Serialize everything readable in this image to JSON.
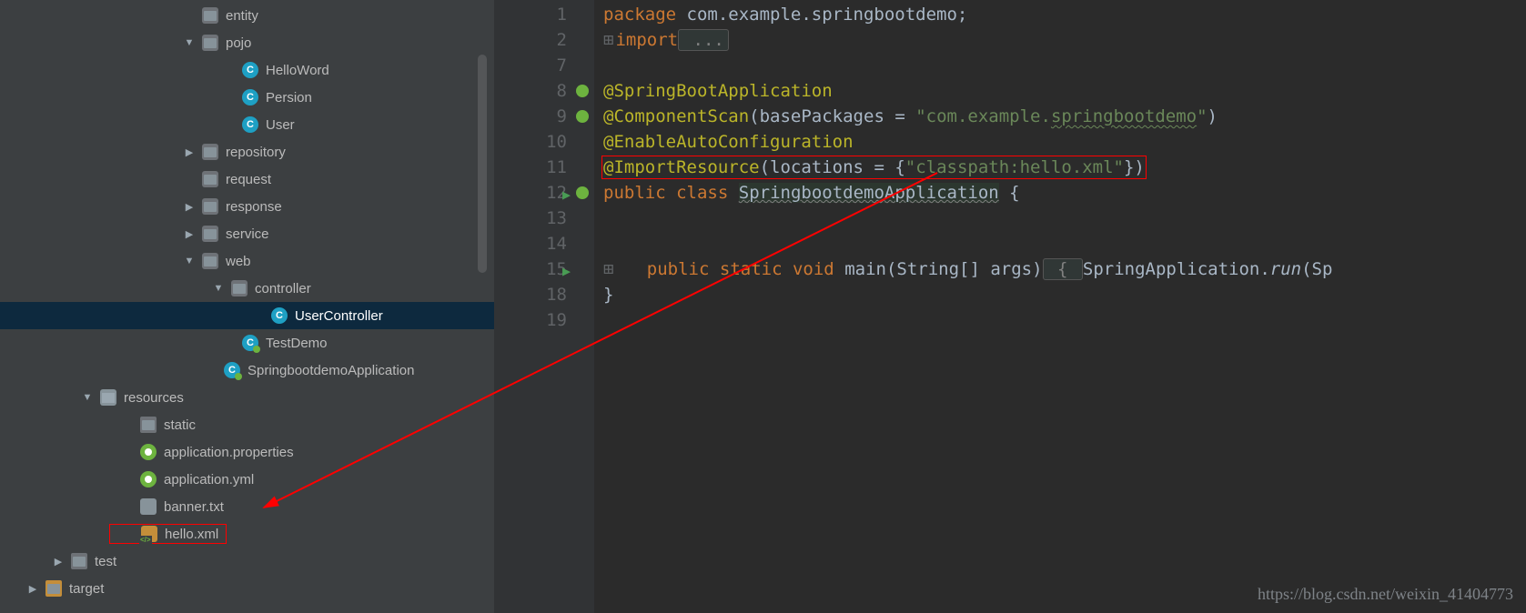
{
  "tree": {
    "entity": "entity",
    "pojo": "pojo",
    "HelloWord": "HelloWord",
    "Persion": "Persion",
    "User": "User",
    "repository": "repository",
    "request": "request",
    "response": "response",
    "service": "service",
    "web": "web",
    "controller": "controller",
    "UserController": "UserController",
    "TestDemo": "TestDemo",
    "SpringbootdemoApplication": "SpringbootdemoApplication",
    "resources": "resources",
    "static": "static",
    "applicationProperties": "application.properties",
    "applicationYml": "application.yml",
    "bannerTxt": "banner.txt",
    "helloXml": "hello.xml",
    "test": "test",
    "target": "target"
  },
  "code": {
    "package_kw": "package",
    "package_name": " com.example.springbootdemo;",
    "import_kw": "import",
    "import_folded": " ...",
    "ann_springboot": "@SpringBootApplication",
    "ann_compscan": "@ComponentScan",
    "compscan_attr": "basePackages",
    "compscan_eq": " = ",
    "compscan_val": "\"com.example.",
    "compscan_val2": "springbootdemo",
    "compscan_close": "\"",
    "paren_close": ")",
    "ann_enable": "@EnableAutoConfiguration",
    "ann_import": "@ImportResource",
    "import_attr": "locations",
    "import_eq": " = {",
    "import_val": "\"classpath:hello.xml\"",
    "import_close": "})",
    "kw_public": "public",
    "kw_class": "class",
    "cls_name": "SpringbootdemoApplication",
    "brace_open": " {",
    "kw_static": "static",
    "kw_void": "void",
    "fn_main": "main",
    "main_args": "(String[] args)",
    "folded_brace": " { ",
    "spring_app": "SpringApplication.",
    "run": "run",
    "run_args": "(Sp",
    "brace_close": "}",
    "gutter": [
      "1",
      "2",
      "7",
      "8",
      "9",
      "10",
      "11",
      "12",
      "13",
      "14",
      "15",
      "18",
      "19"
    ]
  },
  "watermark": "https://blog.csdn.net/weixin_41404773"
}
